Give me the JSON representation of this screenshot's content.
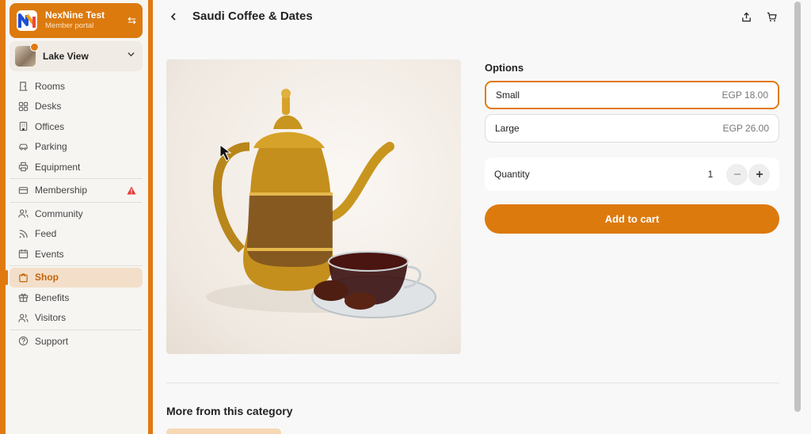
{
  "org": {
    "name": "NexNine Test",
    "subtitle": "Member portal"
  },
  "location": {
    "name": "Lake View"
  },
  "nav": {
    "rooms": "Rooms",
    "desks": "Desks",
    "offices": "Offices",
    "parking": "Parking",
    "equipment": "Equipment",
    "membership": "Membership",
    "community": "Community",
    "feed": "Feed",
    "events": "Events",
    "shop": "Shop",
    "benefits": "Benefits",
    "visitors": "Visitors",
    "support": "Support"
  },
  "product": {
    "title": "Saudi Coffee & Dates",
    "options_title": "Options",
    "options": [
      {
        "name": "Small",
        "price": "EGP 18.00",
        "selected": true
      },
      {
        "name": "Large",
        "price": "EGP 26.00",
        "selected": false
      }
    ],
    "quantity_label": "Quantity",
    "quantity": "1",
    "add_to_cart": "Add to cart"
  },
  "more_title": "More from this category",
  "colors": {
    "accent": "#e07a10",
    "warning": "#e53935"
  }
}
